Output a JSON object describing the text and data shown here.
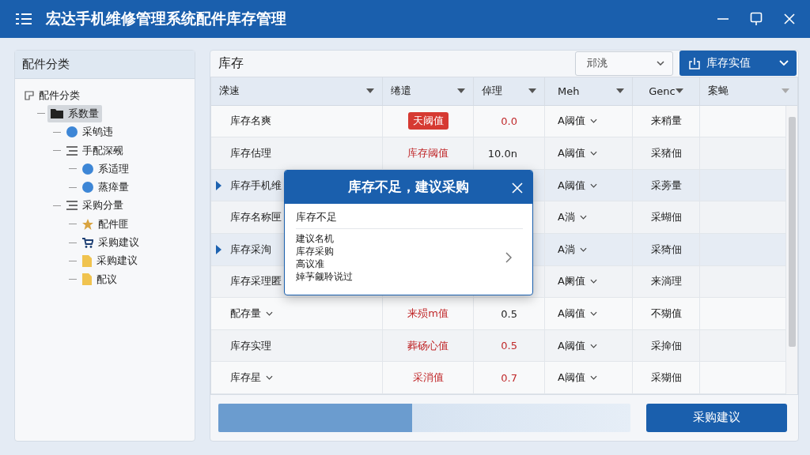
{
  "window": {
    "title": "宏达手机维修管理系统配件库存管理"
  },
  "sidebar": {
    "title": "配件分类",
    "tree": [
      {
        "label": "配件分类",
        "kind": "root",
        "selected": false,
        "children": [
          {
            "label": "系数量",
            "kind": "folder",
            "selected": true,
            "children": [
              {
                "label": "采鸲违",
                "kind": "circle",
                "selected": false
              },
              {
                "label": "手配深觋",
                "kind": "list",
                "selected": false,
                "children": [
                  {
                    "label": "系适理",
                    "kind": "circle",
                    "selected": false
                  },
                  {
                    "label": "蒸瘁量",
                    "kind": "circle",
                    "selected": false
                  }
                ]
              },
              {
                "label": "采购分量",
                "kind": "list",
                "selected": false,
                "children": [
                  {
                    "label": "配件匪",
                    "kind": "star",
                    "selected": false
                  },
                  {
                    "label": "采购建议",
                    "kind": "cart",
                    "selected": false
                  },
                  {
                    "label": "采购建议",
                    "kind": "doc",
                    "selected": false
                  },
                  {
                    "label": "配议",
                    "kind": "doc",
                    "selected": false
                  }
                ]
              }
            ]
          }
        ]
      }
    ]
  },
  "main": {
    "title": "库存",
    "filter": {
      "value": "邧洮"
    },
    "primary_button": {
      "label": "库存实值"
    }
  },
  "table": {
    "columns": [
      "溁速",
      "绻遣",
      "倬理",
      "Meh",
      "Genc",
      "案蝇"
    ],
    "rows": [
      {
        "name": "库存名爽",
        "dropdown": false,
        "selected": false,
        "status": {
          "kind": "badge",
          "text": "天阈值"
        },
        "value": {
          "text": "0.0",
          "alert": true
        },
        "level_col": "A阈值",
        "col_5": "来稍量"
      },
      {
        "name": "库存估理",
        "dropdown": false,
        "selected": false,
        "status": {
          "kind": "text",
          "text": "库存阈值"
        },
        "value": {
          "text": "10.0n",
          "alert": false
        },
        "level_col": "A阈值",
        "col_5": "采猪佃"
      },
      {
        "name": "库存手机维",
        "selected": true,
        "level_col": "A阈值",
        "col_5": "采蒡量"
      },
      {
        "name": "库存名称匣",
        "selected": false,
        "level_col": "A淌",
        "col_5": "采蝴佃"
      },
      {
        "name": "库存采洵",
        "selected": true,
        "level_col": "A淌",
        "col_5": "采猗佃"
      },
      {
        "name": "库存采理匿",
        "selected": false,
        "level_col": "A阑值",
        "col_5": "来淌理"
      },
      {
        "name": "配存量",
        "dropdown": true,
        "selected": false,
        "status": {
          "kind": "text",
          "text": "来殒m值"
        },
        "value": {
          "text": "0.5",
          "alert": false
        },
        "level_col": "A阈值",
        "col_5": "不猢值"
      },
      {
        "name": "库存实理",
        "dropdown": false,
        "selected": false,
        "status": {
          "kind": "text",
          "text": "葬砀心值"
        },
        "value": {
          "text": "0.5",
          "alert": true
        },
        "level_col": "A阈值",
        "col_5": "采掵佃"
      },
      {
        "name": "库存星",
        "dropdown": true,
        "selected": false,
        "status": {
          "kind": "text",
          "text": "采消值"
        },
        "value": {
          "text": "0.7",
          "alert": true
        },
        "level_col": "A阈值",
        "col_5": "采猢佃"
      }
    ]
  },
  "dialog": {
    "title": "库存不足，建议采购",
    "heading": "库存不足",
    "lines": [
      "建议名机",
      "库存采购",
      "高议准",
      "婞芧觎聆说过"
    ]
  },
  "footer": {
    "progress": {
      "level": 0.47
    },
    "button": "采购建议"
  }
}
